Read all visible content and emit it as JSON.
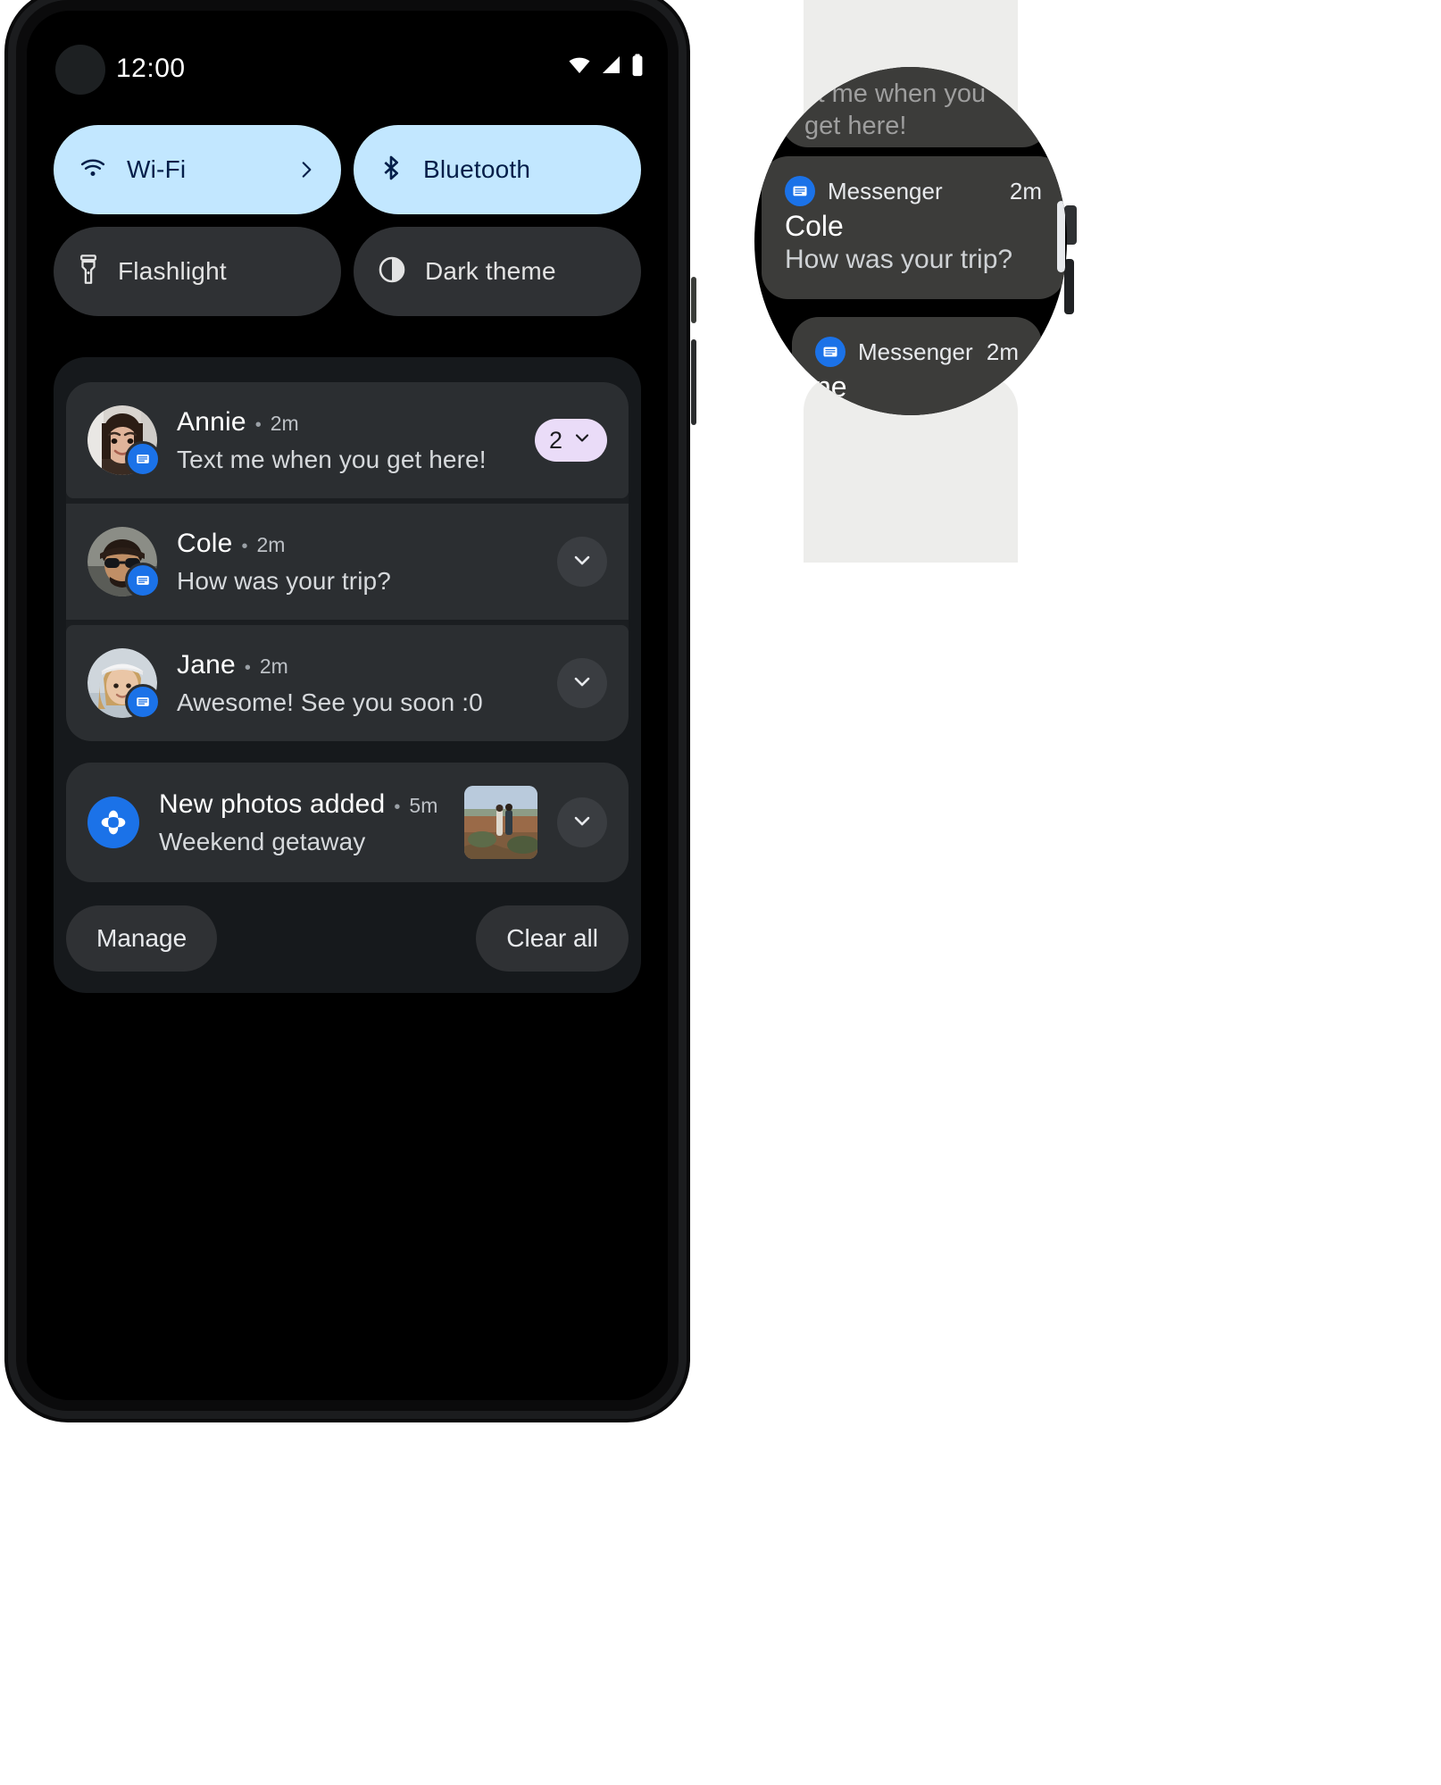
{
  "phone": {
    "status_bar": {
      "time": "12:00",
      "icons": [
        "wifi-icon",
        "cellular-signal-icon",
        "battery-icon"
      ]
    },
    "quick_settings": [
      {
        "label": "Wi-Fi",
        "icon": "wifi-icon",
        "state": "on",
        "has_chevron": true,
        "chevron_icon": "chevron-right-icon"
      },
      {
        "label": "Bluetooth",
        "icon": "bluetooth-icon",
        "state": "on",
        "has_chevron": false
      },
      {
        "label": "Flashlight",
        "icon": "flashlight-icon",
        "state": "off",
        "has_chevron": false
      },
      {
        "label": "Dark theme",
        "icon": "dark-theme-icon",
        "state": "off",
        "has_chevron": false
      }
    ],
    "notifications": [
      {
        "name": "Annie",
        "separator": "•",
        "time": "2m",
        "body": "Text me when you get here!",
        "app_icon": "messenger-icon",
        "avatar": "annie-avatar",
        "count_badge": "2",
        "expand_icon": "chevron-down-icon"
      },
      {
        "name": "Cole",
        "separator": "•",
        "time": "2m",
        "body": "How was your trip?",
        "app_icon": "messenger-icon",
        "avatar": "cole-avatar",
        "count_badge": null,
        "expand_icon": "chevron-down-icon"
      },
      {
        "name": "Jane",
        "separator": "•",
        "time": "2m",
        "body": "Awesome! See you soon :0",
        "app_icon": "messenger-icon",
        "avatar": "jane-avatar",
        "count_badge": null,
        "expand_icon": "chevron-down-icon"
      }
    ],
    "photos_notification": {
      "title": "New photos added",
      "separator": "•",
      "time": "5m",
      "body": "Weekend getaway",
      "app_icon": "google-photos-icon",
      "thumbnail": "couple-on-hillside-thumbnail",
      "expand_icon": "chevron-down-icon"
    },
    "actions": {
      "manage": "Manage",
      "clear_all": "Clear all"
    }
  },
  "watch": {
    "cards": [
      {
        "body_line1": "xt me when you",
        "body_line2": "get here!"
      },
      {
        "app_name": "Messenger",
        "app_icon": "messenger-icon",
        "time": "2m",
        "title": "Cole",
        "body": "How was your trip?"
      },
      {
        "app_name": "Messenger",
        "app_icon": "messenger-icon",
        "time": "2m",
        "title": "ne",
        "body": ""
      }
    ]
  },
  "colors": {
    "tile_on_bg": "#c2e7ff",
    "tile_on_fg": "#041e49",
    "tile_off_bg": "#2f3134",
    "notification_bg": "#2b2e31",
    "badge_bg": "#eadcf8",
    "app_blue": "#1b72e8",
    "band": "#ededeb"
  }
}
